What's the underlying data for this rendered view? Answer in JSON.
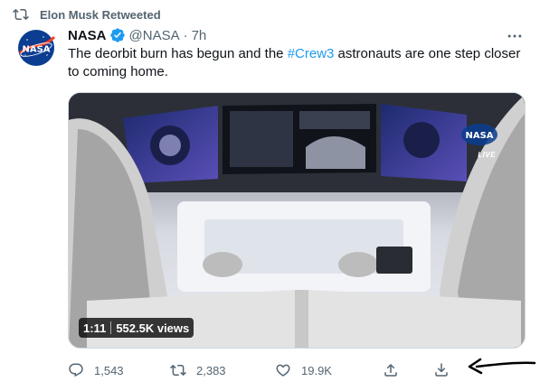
{
  "retweet": {
    "label": "Elon Musk Retweeted",
    "icon": "retweet-icon"
  },
  "author": {
    "name": "NASA",
    "handle": "@NASA",
    "separator": "·",
    "time": "7h",
    "verified_icon": "verified-badge-icon",
    "avatar_text": "NASA"
  },
  "tweet": {
    "text_before": "The deorbit burn has begun and the ",
    "hashtag": "#Crew3",
    "text_after": " astronauts are one step closer to coming home."
  },
  "media": {
    "duration": "1:11",
    "views": "552.5K views",
    "live_logo": "NASA",
    "live_label": "LIVE"
  },
  "actions": {
    "reply": {
      "count": "1,543",
      "icon": "reply-icon"
    },
    "retweet": {
      "count": "2,383",
      "icon": "retweet-icon"
    },
    "like": {
      "count": "19.9K",
      "icon": "heart-icon"
    },
    "share": {
      "icon": "share-icon"
    },
    "download": {
      "icon": "download-icon"
    }
  },
  "colors": {
    "accent": "#1d9bf0",
    "secondary_text": "#536471",
    "primary_text": "#0f1419",
    "nasa_blue": "#0b3d91",
    "nasa_red": "#fc3d21"
  }
}
